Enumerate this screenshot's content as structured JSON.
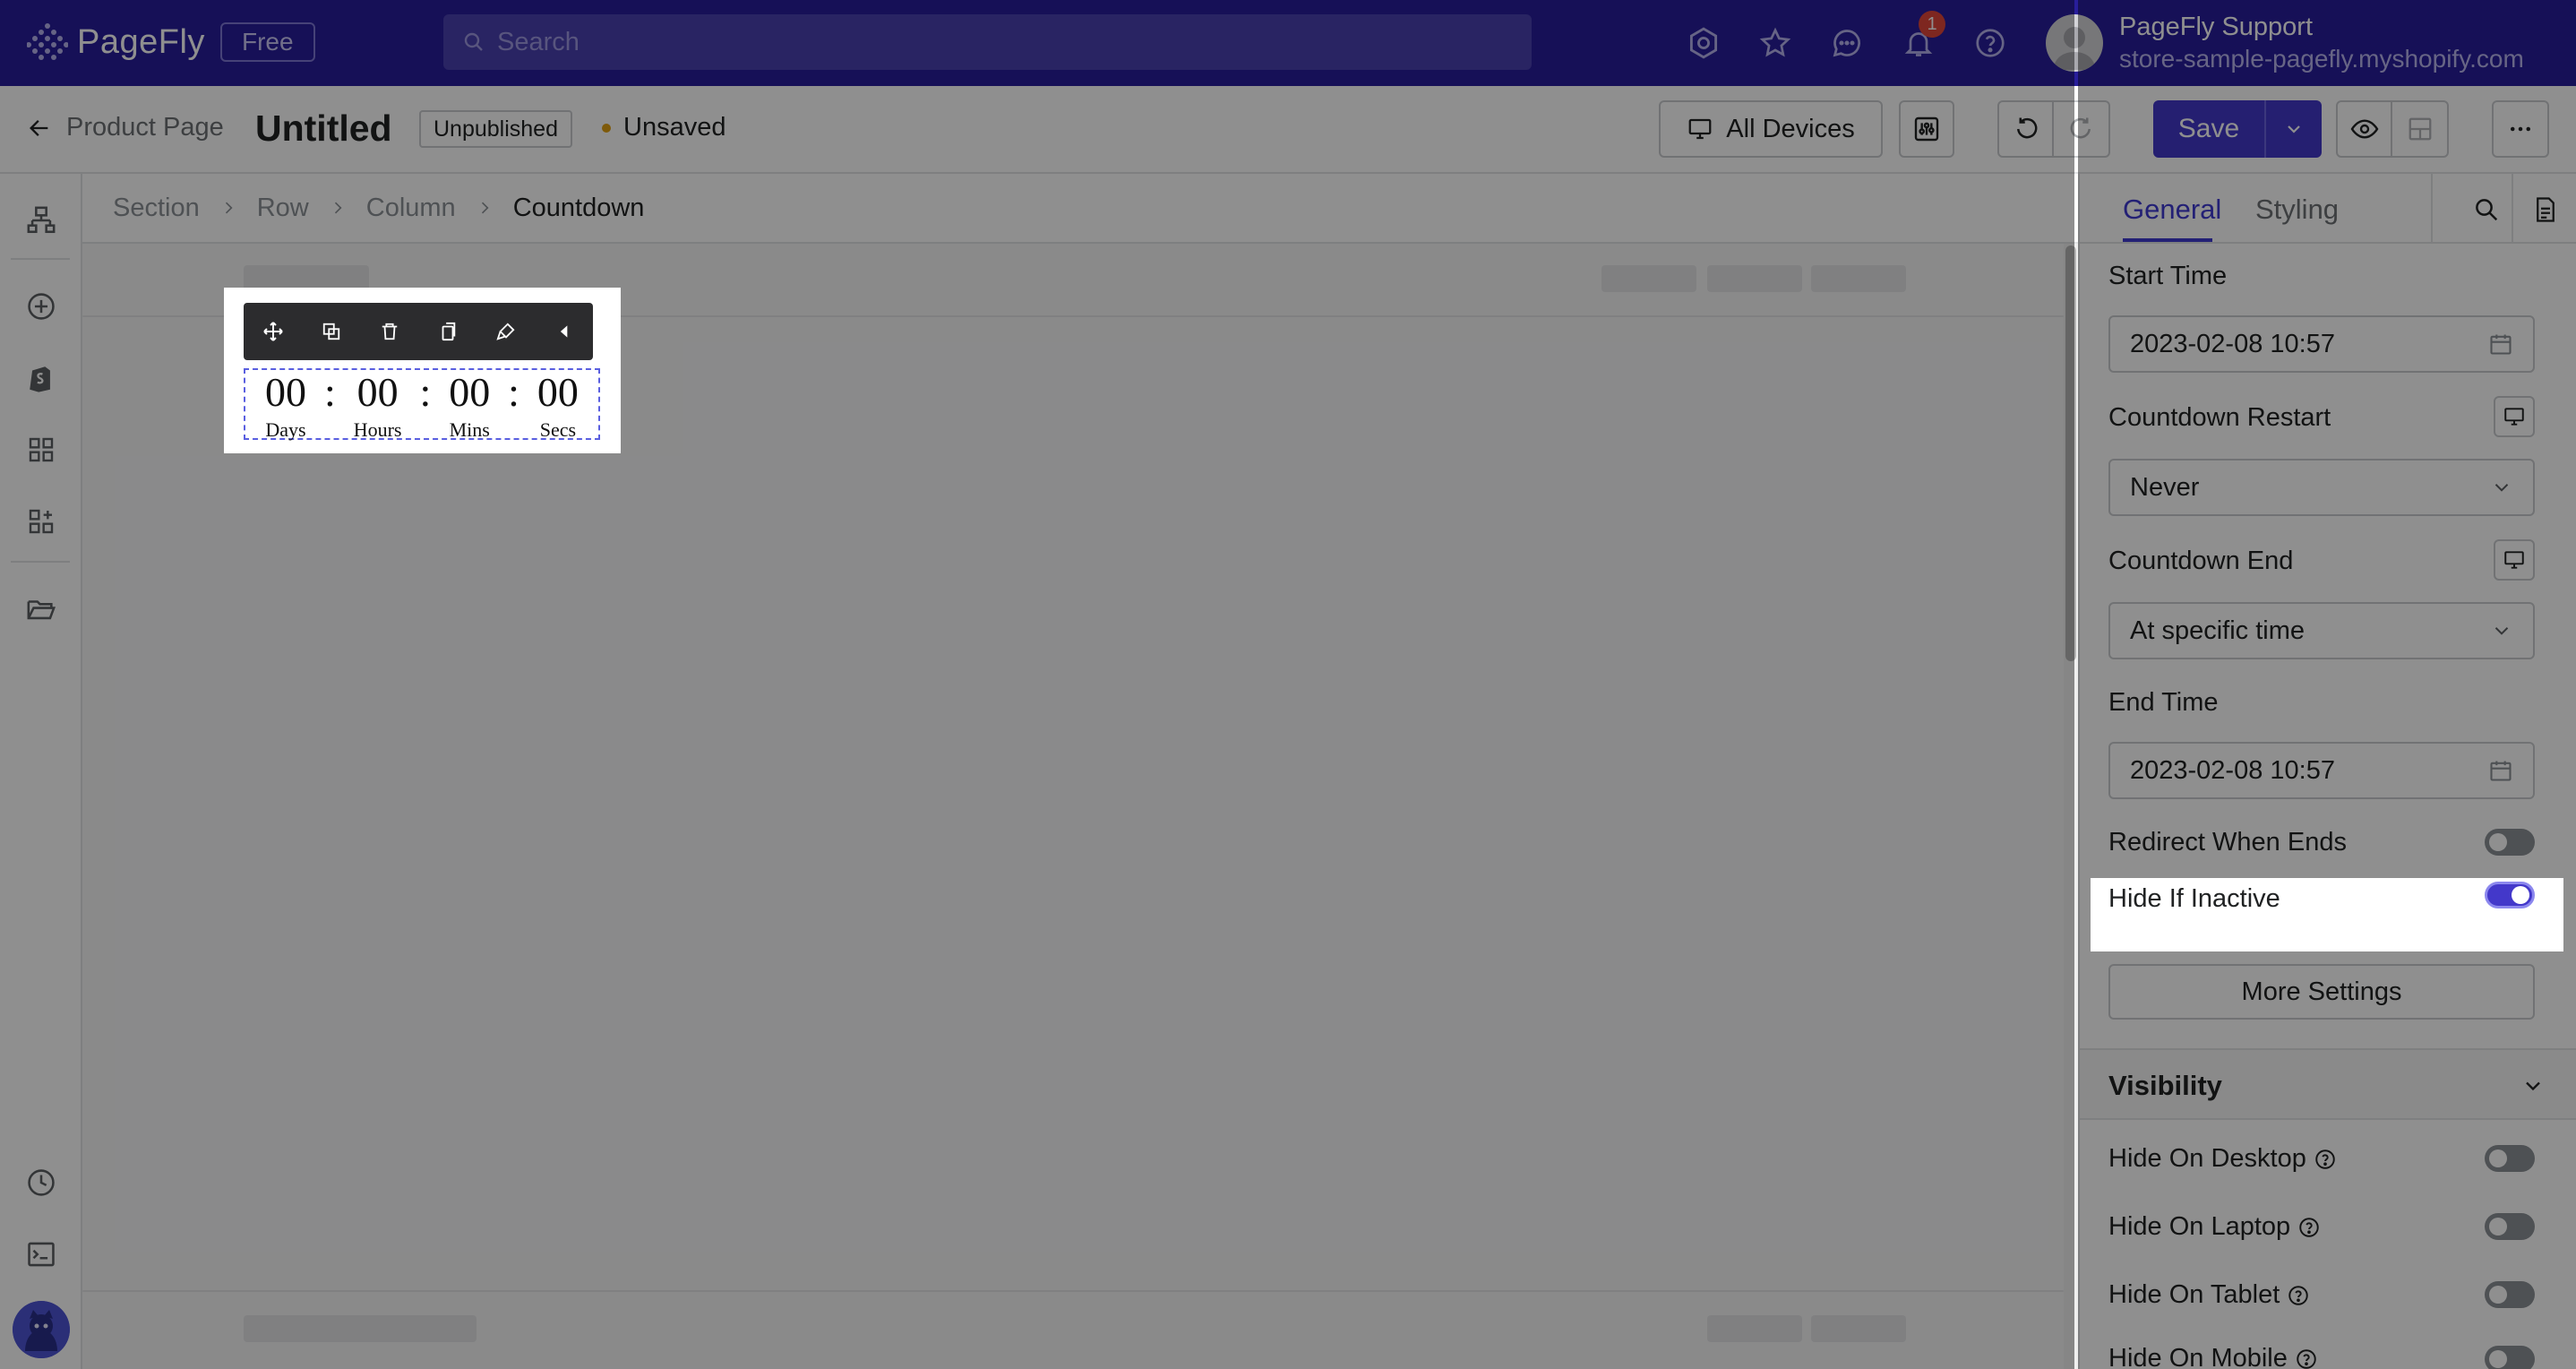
{
  "topbar": {
    "brand": "PageFly",
    "plan": "Free",
    "search_placeholder": "Search",
    "notification_count": "1",
    "user_name": "PageFly Support",
    "user_store": "store-sample-pagefly.myshopify.com",
    "icons": [
      "settings-icon",
      "star-icon",
      "chat-icon",
      "bell-icon",
      "help-icon"
    ]
  },
  "editbar": {
    "back_label": "Product Page",
    "title": "Untitled",
    "status": "Unpublished",
    "save_state": "Unsaved",
    "devices_label": "All Devices",
    "save_label": "Save"
  },
  "breadcrumb": [
    "Section",
    "Row",
    "Column",
    "Countdown"
  ],
  "countdown": {
    "units": [
      {
        "value": "00",
        "label": "Days"
      },
      {
        "value": "00",
        "label": "Hours"
      },
      {
        "value": "00",
        "label": "Mins"
      },
      {
        "value": "00",
        "label": "Secs"
      }
    ],
    "separator": ":"
  },
  "panel": {
    "tabs": [
      "General",
      "Styling"
    ],
    "active_tab": "General",
    "start_time_label": "Start Time",
    "start_time_value": "2023-02-08 10:57",
    "restart_label": "Countdown Restart",
    "restart_value": "Never",
    "end_label": "Countdown End",
    "end_value": "At specific time",
    "end_time_label": "End Time",
    "end_time_value": "2023-02-08 10:57",
    "redirect_label": "Redirect When Ends",
    "redirect_on": false,
    "hide_inactive_label": "Hide If Inactive",
    "hide_inactive_on": true,
    "more_settings_label": "More Settings",
    "visibility_title": "Visibility",
    "visibility": [
      {
        "label": "Hide On Desktop",
        "on": false
      },
      {
        "label": "Hide On Laptop",
        "on": false
      },
      {
        "label": "Hide On Tablet",
        "on": false
      },
      {
        "label": "Hide On Mobile",
        "on": false
      }
    ]
  },
  "colors": {
    "topbar": "#281e9b",
    "accent": "#4338ca",
    "notification": "#e0463a",
    "unsaved_dot": "#e1a012"
  }
}
